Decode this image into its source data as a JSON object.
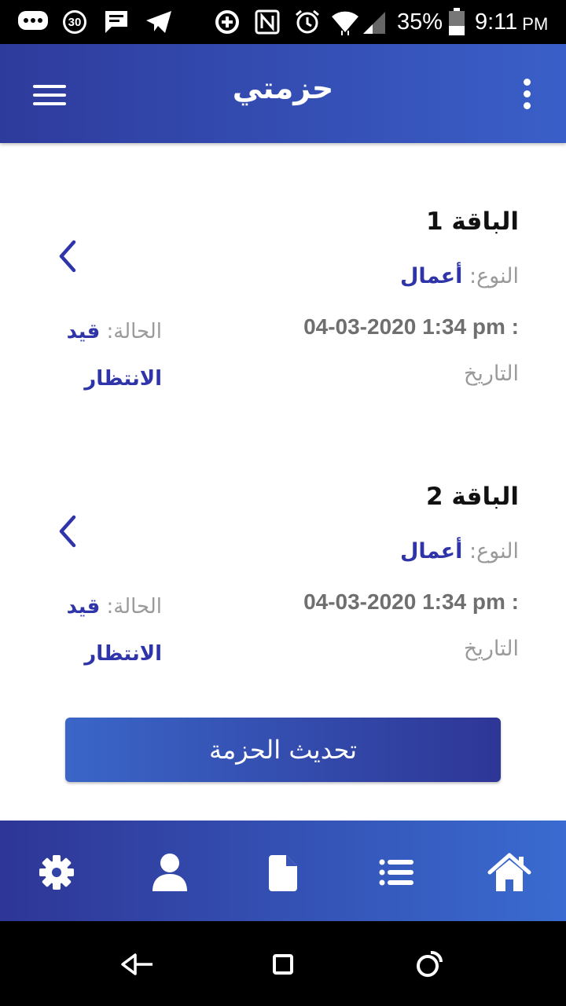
{
  "status_bar": {
    "notif_count": "30",
    "battery": "35%",
    "time": "9:11",
    "ampm": "PM"
  },
  "app_bar": {
    "title": "حزمتي"
  },
  "packages": [
    {
      "title": "الباقة 1",
      "type_label": "النوع:",
      "type_value": "أعمال",
      "date_value": "04-03-2020 1:34 pm :",
      "date_label": "التاريخ",
      "status_label": "الحالة:",
      "status_value": "قيد الانتظار"
    },
    {
      "title": "الباقة 2",
      "type_label": "النوع:",
      "type_value": "أعمال",
      "date_value": "04-03-2020 1:34 pm :",
      "date_label": "التاريخ",
      "status_label": "الحالة:",
      "status_value": "قيد الانتظار"
    }
  ],
  "update_button": {
    "label": "تحديث الحزمة"
  },
  "bottom_nav": {
    "items": [
      {
        "icon": "gear-icon"
      },
      {
        "icon": "user-icon"
      },
      {
        "icon": "document-icon"
      },
      {
        "icon": "list-icon"
      },
      {
        "icon": "home-icon"
      }
    ]
  },
  "colors": {
    "primary": "#2f35a8",
    "gradient_start": "#2e3b9c",
    "gradient_end": "#3a6bd0",
    "label_gray": "#9a9a9a"
  }
}
